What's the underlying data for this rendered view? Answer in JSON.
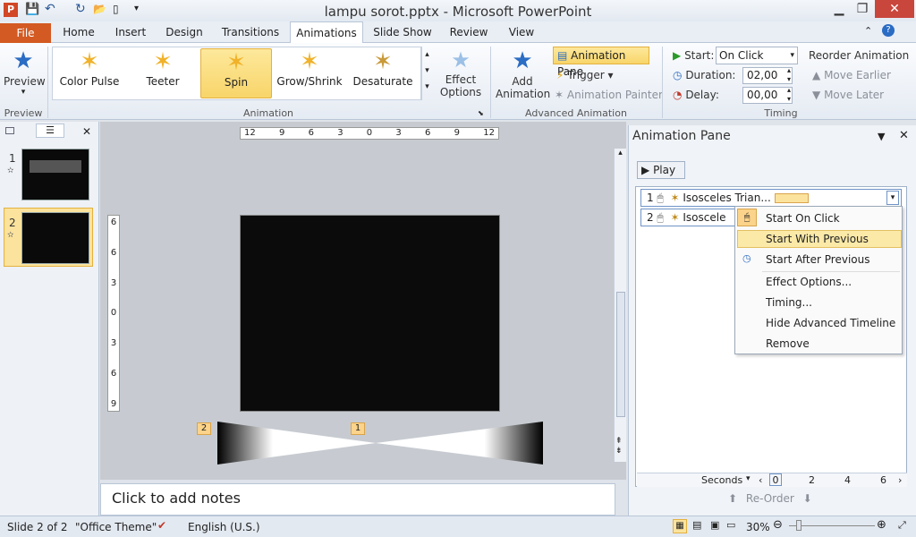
{
  "window": {
    "title": "lampu sorot.pptx  -  Microsoft PowerPoint"
  },
  "tabs": [
    "File",
    "Home",
    "Insert",
    "Design",
    "Transitions",
    "Animations",
    "Slide Show",
    "Review",
    "View"
  ],
  "ribbon": {
    "preview_label": "Preview",
    "preview_group": "Preview",
    "effects": [
      "Color Pulse",
      "Teeter",
      "Spin",
      "Grow/Shrink",
      "Desaturate"
    ],
    "effect_options_line1": "Effect",
    "effect_options_line2": "Options",
    "animation_group": "Animation",
    "add_animation_line1": "Add",
    "add_animation_line2": "Animation",
    "animation_pane_btn": "Animation Pane",
    "trigger": "Trigger",
    "animation_painter": "Animation Painter",
    "advanced_group": "Advanced Animation",
    "start_label": "Start:",
    "start_value": "On Click",
    "duration_label": "Duration:",
    "duration_value": "02,00",
    "delay_label": "Delay:",
    "delay_value": "00,00",
    "timing_group": "Timing",
    "reorder": "Reorder Animation",
    "move_earlier": "Move Earlier",
    "move_later": "Move Later"
  },
  "slides": {
    "n1": "1",
    "n2": "2",
    "thumb1_text": "Slide title lines"
  },
  "ruler_h": [
    "12",
    "9",
    "6",
    "3",
    "0",
    "3",
    "6",
    "9",
    "12"
  ],
  "ruler_v": [
    "6",
    "6",
    "3",
    "0",
    "3",
    "6",
    "9"
  ],
  "slide": {
    "tag1": "1",
    "tag2": "2"
  },
  "notes_placeholder": "Click to add notes",
  "anipane": {
    "title": "Animation Pane",
    "play": "Play",
    "row1_num": "1",
    "row1_name": "Isosceles Trian...",
    "row2_num": "2",
    "row2_name": "Isoscele",
    "menu": [
      "Start On Click",
      "Start With Previous",
      "Start After Previous",
      "Effect Options...",
      "Timing...",
      "Hide Advanced Timeline",
      "Remove"
    ],
    "seconds": "Seconds",
    "timeline": [
      "0",
      "2",
      "4",
      "6"
    ],
    "reorder": "Re-Order"
  },
  "status": {
    "slide": "Slide 2 of 2",
    "theme": "\"Office Theme\"",
    "lang": "English (U.S.)",
    "zoom": "30%"
  }
}
